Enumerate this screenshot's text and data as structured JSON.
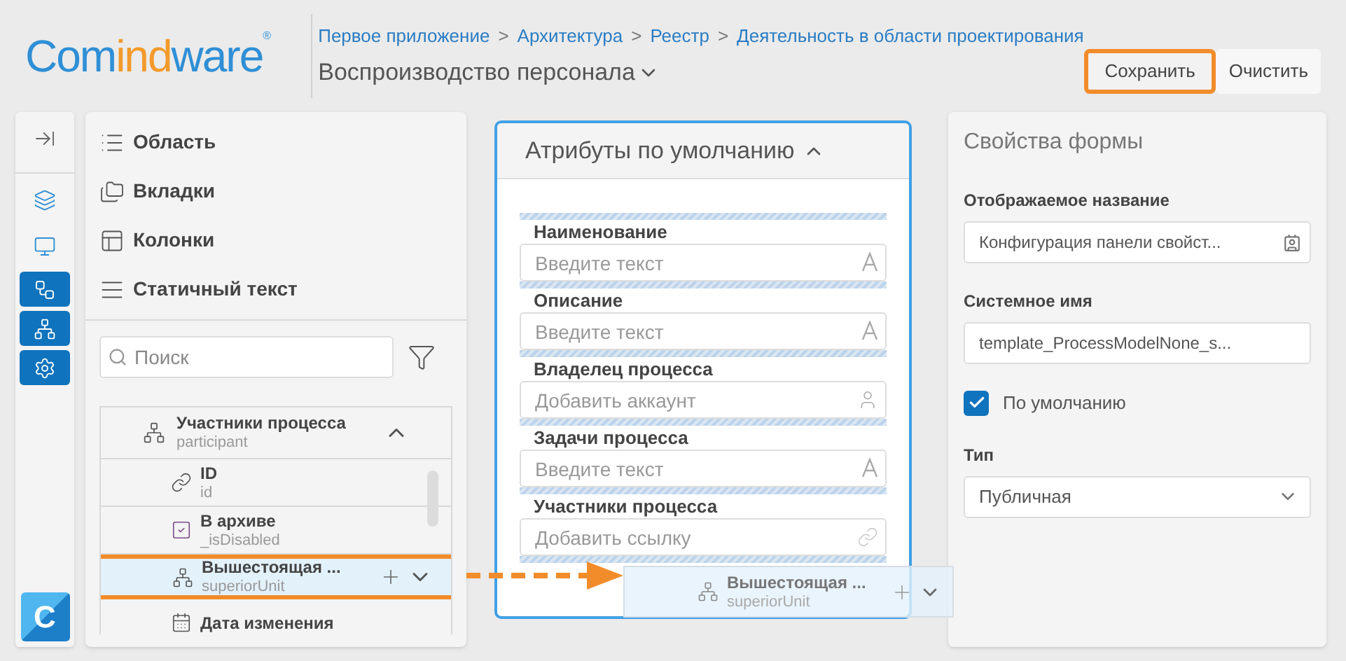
{
  "logo": {
    "parts": [
      {
        "text": "Com",
        "accent": false
      },
      {
        "text": "ind",
        "accent": true
      },
      {
        "text": "ware",
        "accent": false
      }
    ],
    "mark": "®"
  },
  "breadcrumbs": [
    "Первое приложение",
    "Архитектура",
    "Реестр",
    "Деятельность в области проектирования"
  ],
  "separator": ">",
  "page_title": "Воспроизводство персонала",
  "actions": [
    {
      "label": "Сохранить",
      "highlighted": true
    },
    {
      "label": "Очистить",
      "highlighted": false
    }
  ],
  "rail": [
    {
      "kind": "collapse",
      "highlighted": false
    },
    {
      "kind": "layers",
      "highlighted": false
    },
    {
      "kind": "monitor",
      "highlighted": false
    },
    {
      "kind": "flow",
      "highlighted": true
    },
    {
      "kind": "hierarchy",
      "highlighted": true
    },
    {
      "kind": "settings",
      "highlighted": true
    }
  ],
  "app_icon": "C",
  "palette": [
    {
      "kind": "list",
      "label": "Область"
    },
    {
      "kind": "folder",
      "label": "Вкладки"
    },
    {
      "kind": "columns",
      "label": "Колонки"
    },
    {
      "kind": "text",
      "label": "Статичный текст"
    }
  ],
  "search": {
    "placeholder": "Поиск"
  },
  "tree": {
    "label": "Участники процесса",
    "sub": "participant",
    "expanded": true,
    "children": [
      {
        "kind": "link",
        "label": "ID",
        "sub": "id",
        "dragging": false
      },
      {
        "kind": "checkbox",
        "label": "В архиве",
        "sub": "_isDisabled",
        "dragging": false
      },
      {
        "kind": "hierarchy",
        "label": "Вышестоящая ...",
        "sub": "superiorUnit",
        "dragging": true
      },
      {
        "kind": "calendar",
        "label": "Дата изменения",
        "dragging": false
      }
    ]
  },
  "form": {
    "title": "Атрибуты по умолчанию",
    "expanded": true,
    "fields": [
      {
        "label": "Наименование",
        "placeholder": "Введите текст",
        "kind": "text"
      },
      {
        "label": "Описание",
        "placeholder": "Введите текст",
        "kind": "text"
      },
      {
        "label": "Владелец процесса",
        "placeholder": "Добавить аккаунт",
        "kind": "account"
      },
      {
        "label": "Задачи процесса",
        "placeholder": "Введите текст",
        "kind": "text"
      },
      {
        "label": "Участники процесса",
        "placeholder": "Добавить ссылку",
        "kind": "link"
      }
    ]
  },
  "ghost": {
    "label": "Вышестоящая ...",
    "sub": "superiorUnit"
  },
  "properties": {
    "title": "Свойства формы",
    "display_name": {
      "label": "Отображаемое название",
      "value": "Конфигурация панели свойст..."
    },
    "system_name": {
      "label": "Системное имя",
      "value": "template_ProcessModelNone_s..."
    },
    "default": {
      "label": "По умолчанию",
      "checked": true
    },
    "type": {
      "label": "Тип",
      "value": "Публичная"
    }
  }
}
